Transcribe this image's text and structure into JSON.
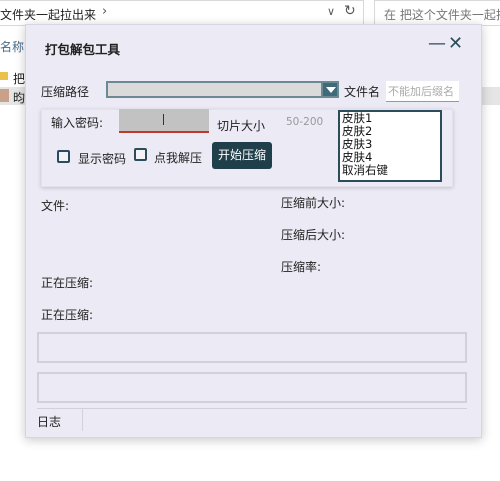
{
  "explorer": {
    "path": "文件夹一起拉出来",
    "search_placeholder": "在 把这个文件夹一起拉出",
    "column_name": "名称",
    "rows": [
      {
        "label": "把"
      },
      {
        "label": "昀"
      }
    ]
  },
  "dialog": {
    "title": "打包解包工具",
    "compress_path_label": "压缩路径",
    "compress_path_value": "",
    "file_name_label": "文件名",
    "file_name_placeholder": "不能加后缀名",
    "password_label": "输入密码:",
    "password_value": "",
    "slice_size_label": "切片大小",
    "slice_size_placeholder": "50-200",
    "show_password_label": "显示密码",
    "click_decompress_label": "点我解压",
    "start_button_label": "开始压缩",
    "skins": [
      "皮肤1",
      "皮肤2",
      "皮肤3",
      "皮肤4",
      "取消右键"
    ],
    "file_label": "文件:",
    "before_size_label": "压缩前大小:",
    "after_size_label": "压缩后大小:",
    "ratio_label": "压缩率:",
    "compressing_label_1": "正在压缩:",
    "compressing_label_2": "正在压缩:",
    "log_tab": "日志"
  }
}
